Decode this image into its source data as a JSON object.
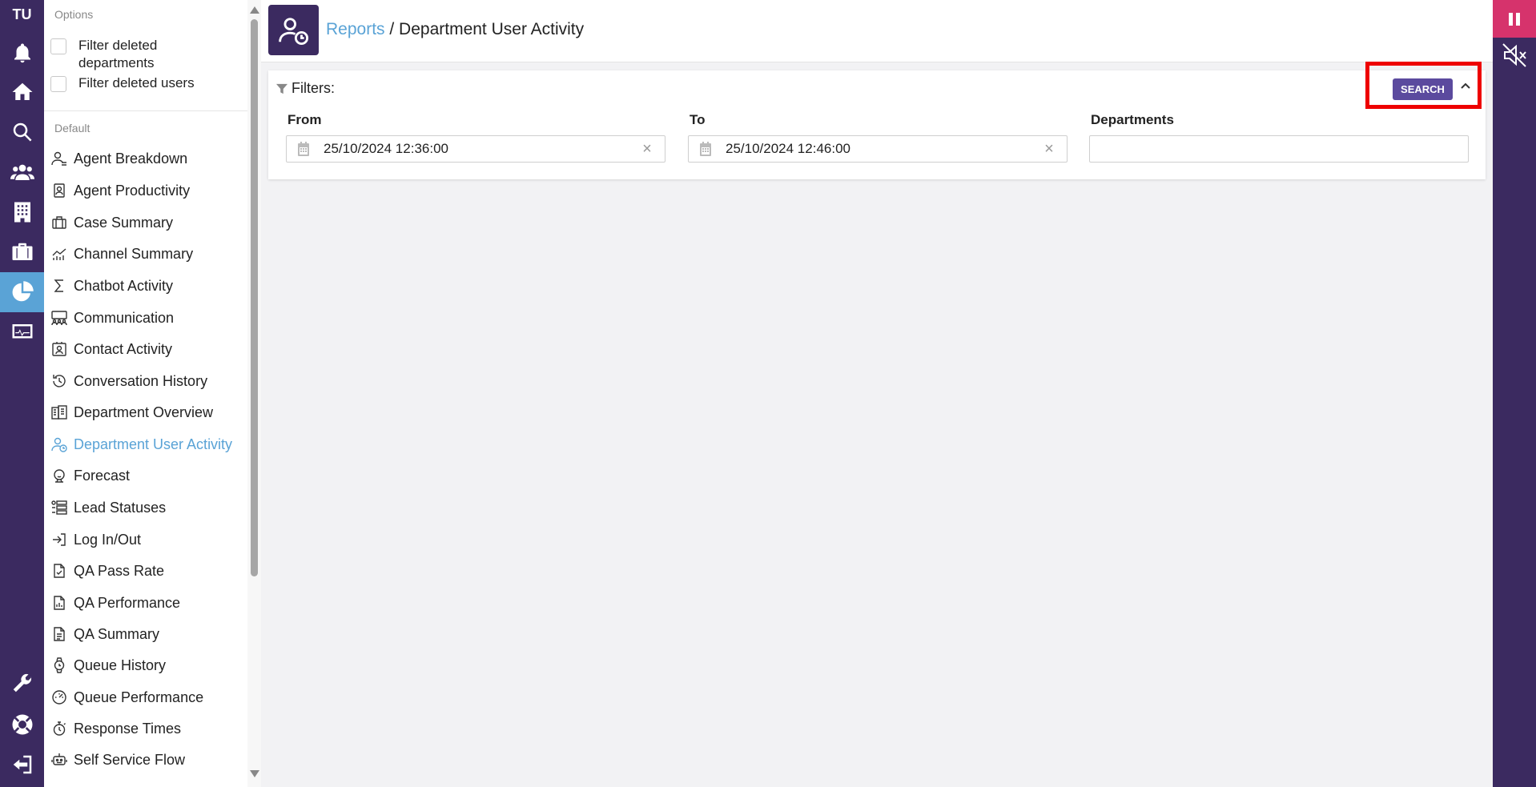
{
  "rail": {
    "logo": "TU",
    "items": [
      {
        "icon": "bell-icon"
      },
      {
        "icon": "home-icon"
      },
      {
        "icon": "search-icon"
      },
      {
        "icon": "users-icon"
      },
      {
        "icon": "building-icon"
      },
      {
        "icon": "briefcase-icon"
      },
      {
        "icon": "pie-chart-icon",
        "active": true
      },
      {
        "icon": "monitor-icon"
      },
      {
        "icon": "wrench-icon"
      },
      {
        "icon": "lifebuoy-icon"
      },
      {
        "icon": "logout-icon"
      }
    ]
  },
  "menu": {
    "options_heading": "Options",
    "options": [
      {
        "label": "Filter deleted departments",
        "checked": false
      },
      {
        "label": "Filter deleted users",
        "checked": false
      }
    ],
    "default_heading": "Default",
    "items": [
      {
        "label": "Agent Breakdown",
        "icon": "agent-breakdown-icon"
      },
      {
        "label": "Agent Productivity",
        "icon": "agent-productivity-icon"
      },
      {
        "label": "Case Summary",
        "icon": "case-summary-icon"
      },
      {
        "label": "Channel Summary",
        "icon": "channel-summary-icon"
      },
      {
        "label": "Chatbot Activity",
        "icon": "sigma-icon"
      },
      {
        "label": "Communication",
        "icon": "communication-icon"
      },
      {
        "label": "Contact Activity",
        "icon": "contact-card-icon"
      },
      {
        "label": "Conversation History",
        "icon": "history-icon"
      },
      {
        "label": "Department Overview",
        "icon": "department-overview-icon"
      },
      {
        "label": "Department User Activity",
        "icon": "user-clock-icon",
        "active": true
      },
      {
        "label": "Forecast",
        "icon": "forecast-icon"
      },
      {
        "label": "Lead Statuses",
        "icon": "lead-statuses-icon"
      },
      {
        "label": "Log In/Out",
        "icon": "login-icon"
      },
      {
        "label": "QA Pass Rate",
        "icon": "qa-pass-icon"
      },
      {
        "label": "QA Performance",
        "icon": "qa-performance-icon"
      },
      {
        "label": "QA Summary",
        "icon": "qa-summary-icon"
      },
      {
        "label": "Queue History",
        "icon": "watch-icon"
      },
      {
        "label": "Queue Performance",
        "icon": "gauge-icon"
      },
      {
        "label": "Response Times",
        "icon": "stopwatch-icon"
      },
      {
        "label": "Self Service Flow",
        "icon": "robot-icon"
      }
    ]
  },
  "header": {
    "breadcrumb_link": "Reports",
    "breadcrumb_sep": " / ",
    "breadcrumb_current": "Department User Activity"
  },
  "filters": {
    "title": "Filters:",
    "search_label": "SEARCH",
    "from_label": "From",
    "from_value": "25/10/2024 12:36:00",
    "to_label": "To",
    "to_value": "25/10/2024 12:46:00",
    "departments_label": "Departments",
    "departments_value": ""
  },
  "colors": {
    "rail": "#3b2a60",
    "accent": "#5aa3d6",
    "button": "#5b4a9e",
    "highlight": "#e00000",
    "pause": "#d6336c"
  }
}
